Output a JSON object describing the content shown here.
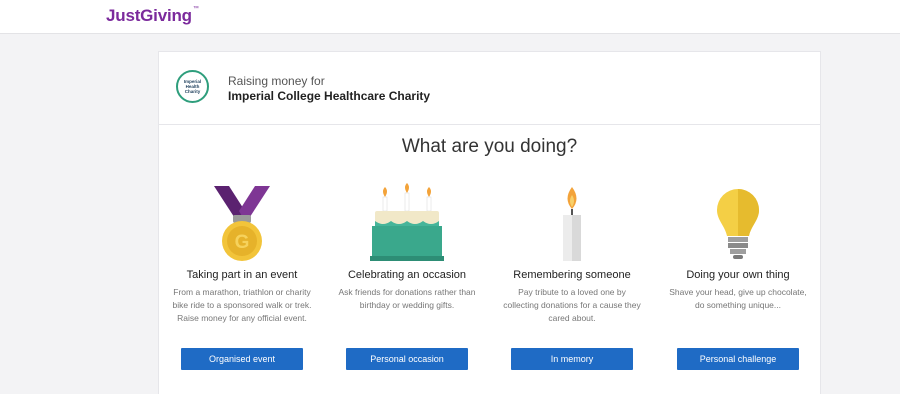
{
  "header": {
    "logo": "JustGiving",
    "logo_tm": "™"
  },
  "charity": {
    "logo_text": "Imperial\nHealth\nCharity",
    "raising_label": "Raising money for",
    "name": "Imperial College Healthcare Charity"
  },
  "heading": "What are you doing?",
  "options": [
    {
      "icon": "medal-icon",
      "title": "Taking part in an event",
      "description": "From a marathon, triathlon or charity bike ride to a sponsored walk or trek. Raise money for any official event.",
      "button": "Organised event"
    },
    {
      "icon": "birthday-cake-icon",
      "title": "Celebrating an occasion",
      "description": "Ask friends for donations rather than birthday or wedding gifts.",
      "button": "Personal occasion"
    },
    {
      "icon": "candle-icon",
      "title": "Remembering someone",
      "description": "Pay tribute to a loved one by collecting donations for a cause they cared about.",
      "button": "In memory"
    },
    {
      "icon": "lightbulb-icon",
      "title": "Doing your own thing",
      "description": "Shave your head, give up chocolate, do something unique...",
      "button": "Personal challenge"
    }
  ],
  "colors": {
    "brand": "#7b2a9c",
    "button": "#1f6bc5",
    "charity_accent": "#2e9e7c"
  }
}
